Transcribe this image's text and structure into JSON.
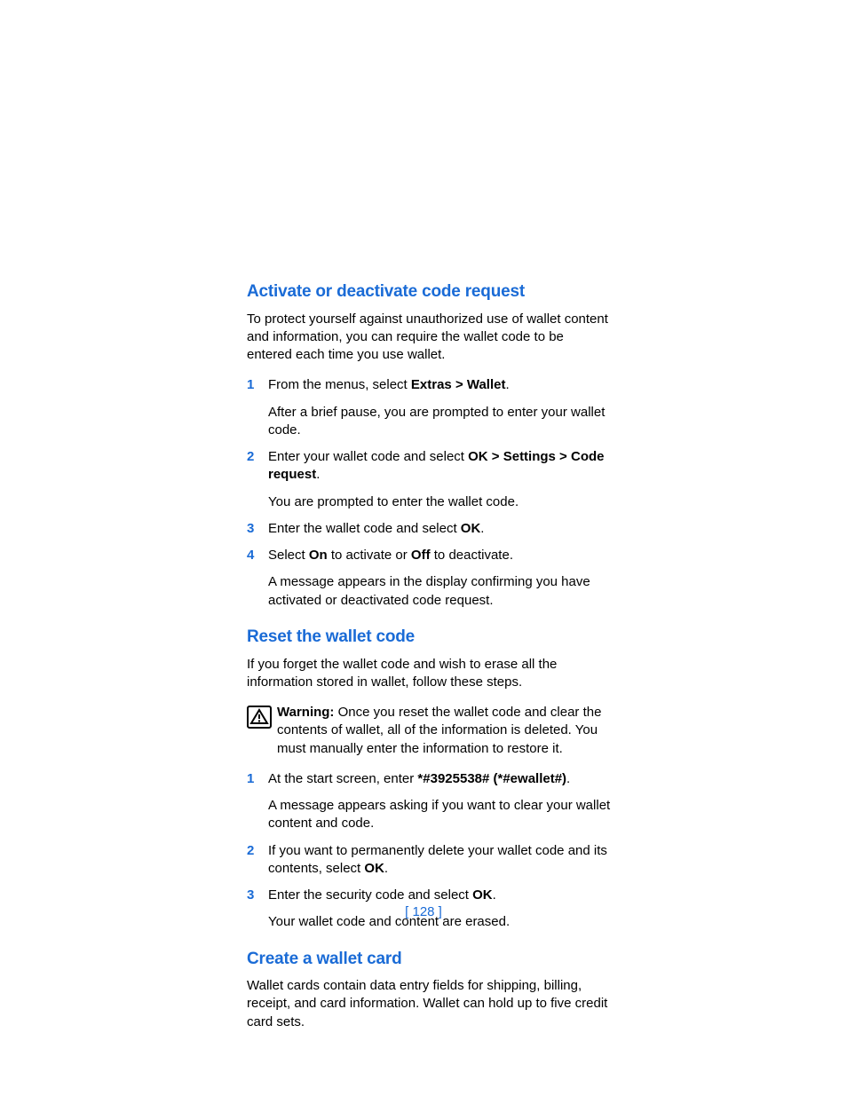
{
  "pageNumber": "[ 128 ]",
  "sections": {
    "activate": {
      "heading": "Activate or deactivate code request",
      "intro": "To protect yourself against unauthorized use of wallet content and information, you can require the wallet code to be entered each time you use wallet.",
      "steps": {
        "s1": {
          "num": "1",
          "pre": "From the menus, select ",
          "bold": "Extras > Wallet",
          "post": ".",
          "follow": "After a brief pause, you are prompted to enter your wallet code."
        },
        "s2": {
          "num": "2",
          "pre": "Enter your wallet code and select ",
          "bold": "OK > Settings > Code request",
          "post": ".",
          "follow": "You are prompted to enter the wallet code."
        },
        "s3": {
          "num": "3",
          "pre": "Enter the wallet code and select ",
          "bold": "OK",
          "post": "."
        },
        "s4": {
          "num": "4",
          "pre": "Select ",
          "boldA": "On",
          "mid": " to activate or ",
          "boldB": "Off",
          "post": " to deactivate.",
          "follow": "A message appears in the display confirming you have activated or deactivated code request."
        }
      }
    },
    "reset": {
      "heading": "Reset the wallet code",
      "intro": "If you forget the wallet code and wish to erase all the information stored in wallet, follow these steps.",
      "warning": {
        "label": "Warning:",
        "text": " Once you reset the wallet code and clear the contents of wallet, all of the information is deleted. You must manually enter the information to restore it."
      },
      "steps": {
        "s1": {
          "num": "1",
          "pre": "At the start screen, enter ",
          "bold": "*#3925538# (*#ewallet#)",
          "post": ".",
          "follow": "A message appears asking if you want to clear your wallet content and code."
        },
        "s2": {
          "num": "2",
          "pre": "If you want to permanently delete your wallet code and its contents, select ",
          "bold": "OK",
          "post": "."
        },
        "s3": {
          "num": "3",
          "pre": "Enter the security code and select ",
          "bold": "OK",
          "post": ".",
          "follow": " Your wallet code and content are erased."
        }
      }
    },
    "create": {
      "heading": "Create a wallet card",
      "intro": "Wallet cards contain data entry fields for shipping, billing, receipt, and card information. Wallet can hold up to five credit card sets."
    }
  }
}
